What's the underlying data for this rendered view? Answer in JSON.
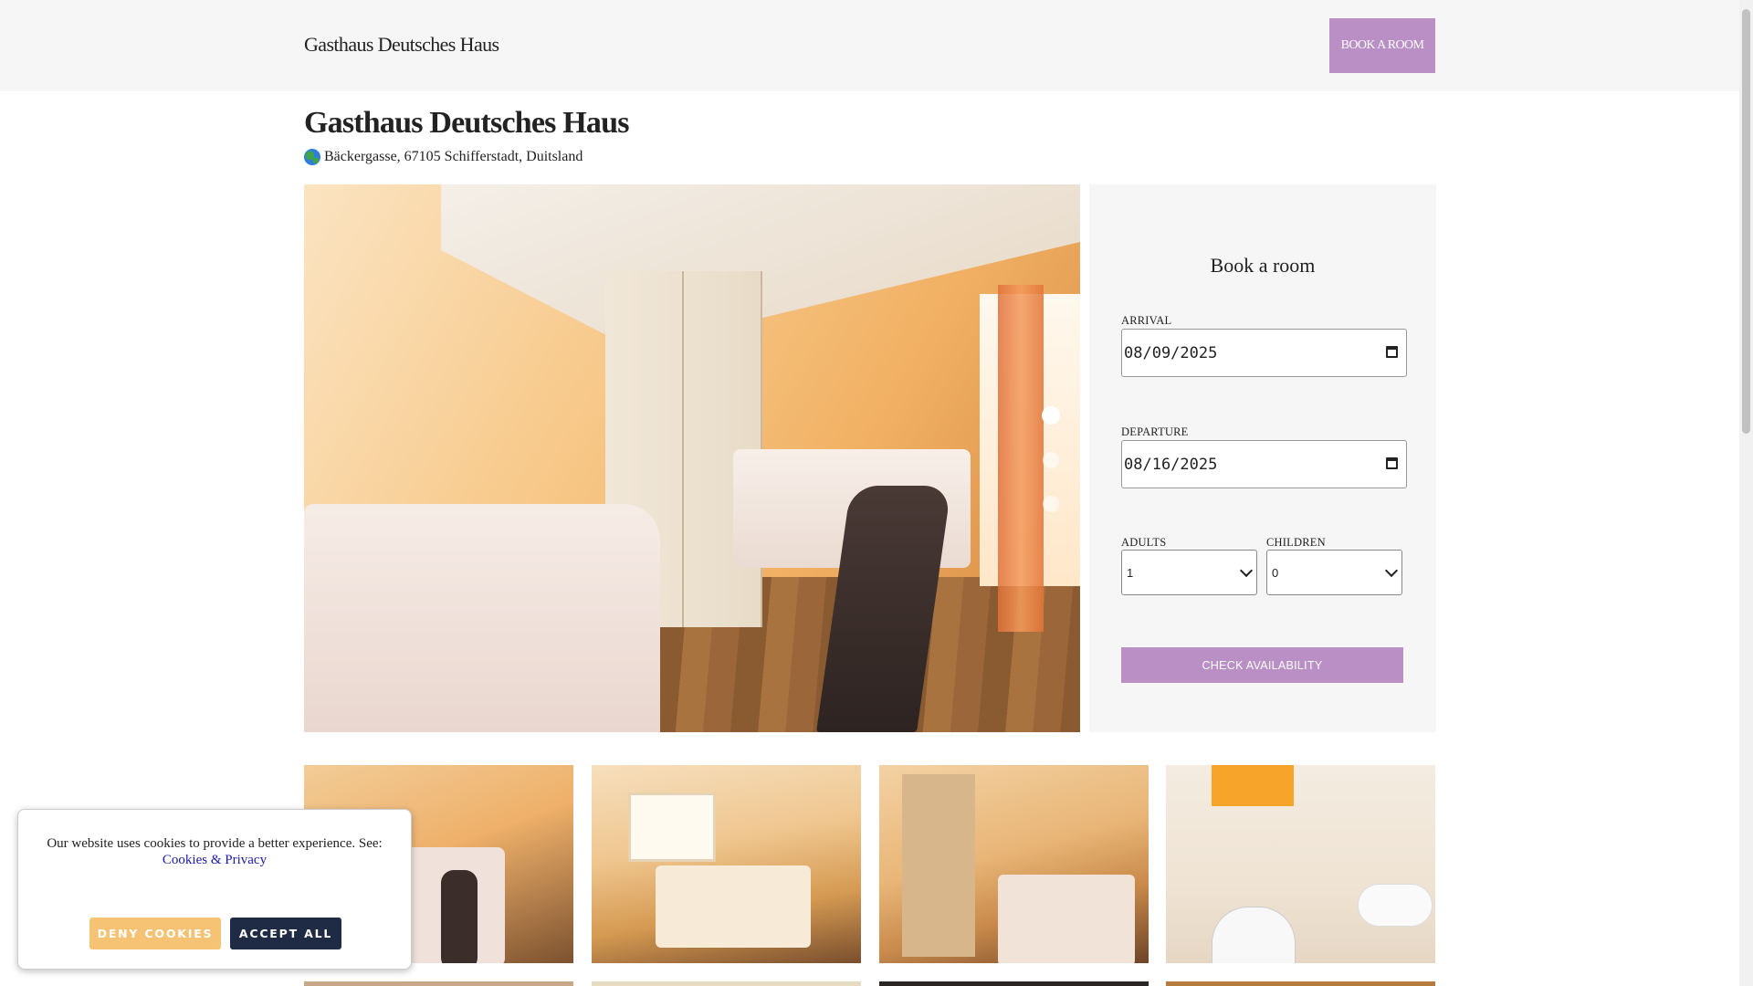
{
  "header": {
    "brand": "Gasthaus Deutsches Haus",
    "book_button": "BOOK A ROOM"
  },
  "hotel": {
    "name": "Gasthaus Deutsches Haus",
    "address": "Bäckergasse, 67105 Schifferstadt, Duitsland"
  },
  "carousel": {
    "slide_count": 3,
    "active_index": 0
  },
  "booking": {
    "title": "Book a room",
    "arrival_label": "ARRIVAL",
    "arrival_value": "08/09/2025",
    "departure_label": "DEPARTURE",
    "departure_value": "08/16/2025",
    "adults_label": "ADULTS",
    "adults_value": "1",
    "children_label": "CHILDREN",
    "children_value": "0",
    "check_button": "CHECK AVAILABILITY"
  },
  "cookie_banner": {
    "message": "Our website uses cookies to provide a better experience. See:",
    "link": "Cookies & Privacy",
    "deny_button": "DENY COOKIES",
    "accept_button": "ACCEPT ALL"
  },
  "colors": {
    "accent": "#b98fc6",
    "deny": "#f6c273",
    "accept": "#1f2a44",
    "link": "#1a1aa6"
  }
}
